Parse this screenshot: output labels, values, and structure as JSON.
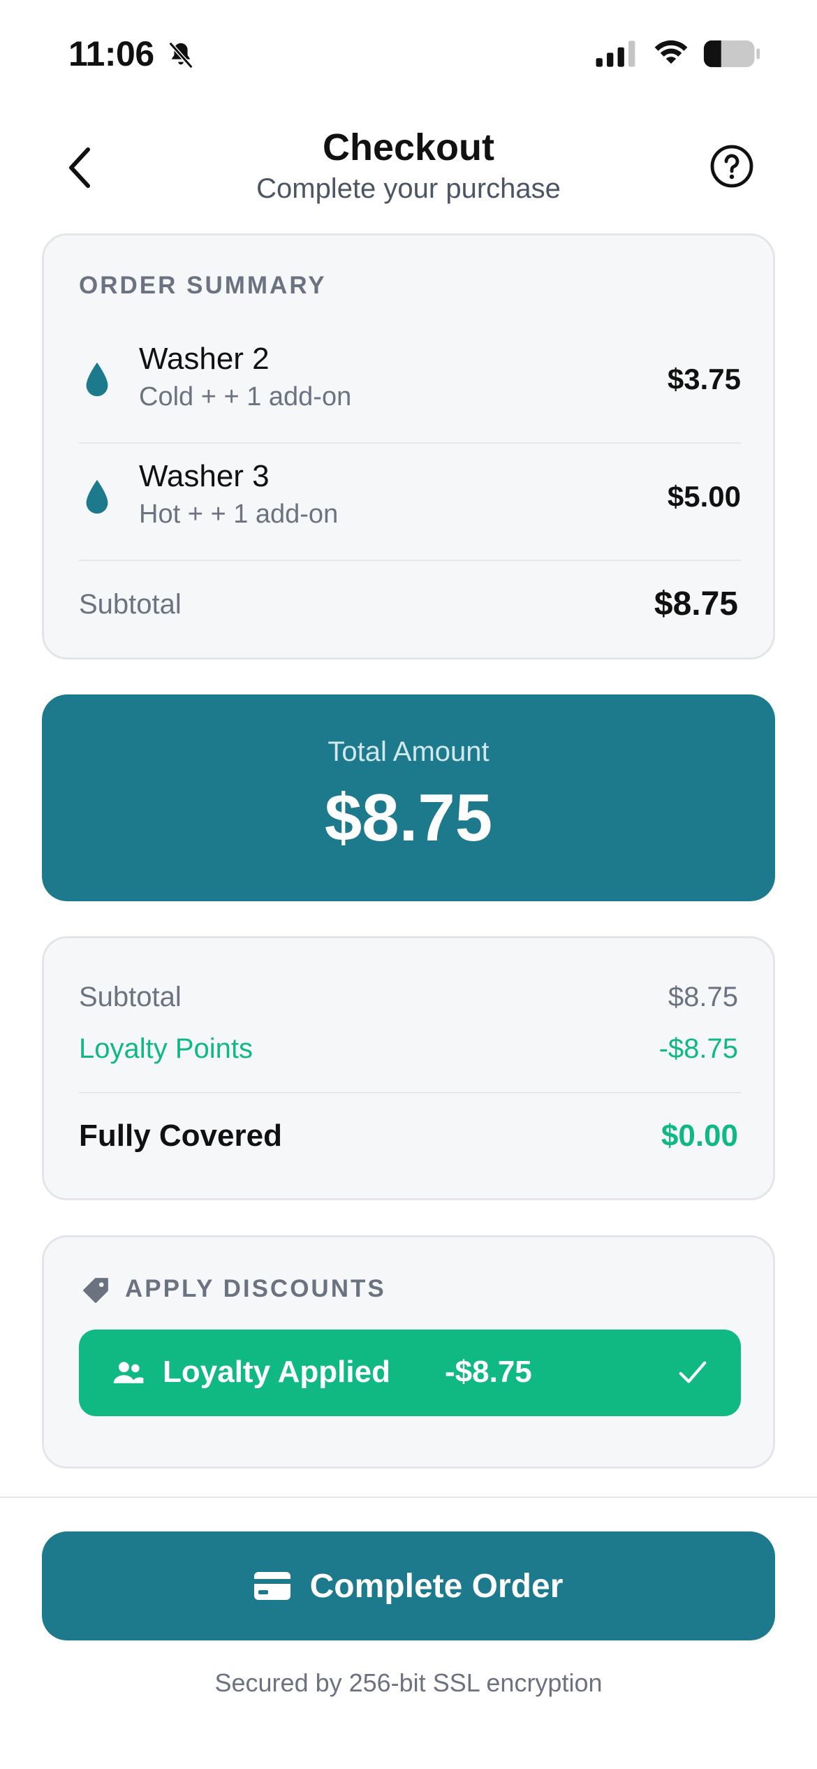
{
  "status_bar": {
    "time": "11:06",
    "icons": [
      "bell-slash-icon",
      "signal-icon",
      "wifi-icon",
      "battery-icon"
    ]
  },
  "header": {
    "title": "Checkout",
    "subtitle": "Complete your purchase",
    "back_icon": "chevron-left-icon",
    "help_icon": "question-circle-icon"
  },
  "order_summary": {
    "label": "ORDER SUMMARY",
    "items": [
      {
        "icon": "water-drop-icon",
        "name": "Washer 2",
        "detail": "Cold + + 1 add-on",
        "price": "$3.75"
      },
      {
        "icon": "water-drop-icon",
        "name": "Washer 3",
        "detail": "Hot + + 1 add-on",
        "price": "$5.00"
      }
    ],
    "subtotal_label": "Subtotal",
    "subtotal_value": "$8.75"
  },
  "total": {
    "label": "Total Amount",
    "value": "$8.75"
  },
  "breakdown": {
    "subtotal_label": "Subtotal",
    "subtotal_value": "$8.75",
    "loyalty_label": "Loyalty Points",
    "loyalty_value": "-$8.75",
    "covered_label": "Fully Covered",
    "covered_value": "$0.00"
  },
  "discounts": {
    "label": "APPLY DISCOUNTS",
    "icon": "tag-icon",
    "applied_label": "Loyalty Applied",
    "applied_amount": "-$8.75",
    "applied_icon": "people-icon",
    "check_icon": "checkmark-icon"
  },
  "footer": {
    "button_label": "Complete Order",
    "button_icon": "credit-card-icon",
    "security_note": "Secured by 256-bit SSL encryption"
  },
  "colors": {
    "primary": "#1c7a8c",
    "success": "#10b981",
    "muted_text": "#6b7280",
    "card_bg": "#f6f7f9"
  }
}
